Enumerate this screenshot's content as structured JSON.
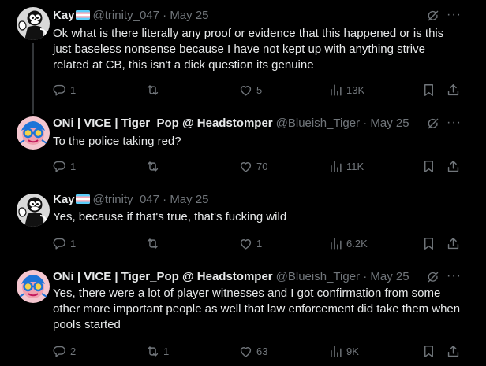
{
  "tweets": [
    {
      "name": "Kay",
      "handle": "@trinity_047",
      "dot": "·",
      "date": "May 25",
      "text": "Ok what is there literally any proof or evidence that this happened or is this just baseless nonsense because I have not kept up with anything strive related at CB, this isn't a dick question its genuine",
      "replies": "1",
      "retweets": "",
      "likes": "5",
      "views": "13K"
    },
    {
      "name": "ONi | VICE | Tiger_Pop @ Headstomper",
      "handle": "@Blueish_Tiger",
      "dot": "·",
      "date": "May 25",
      "text": "To the police taking red?",
      "replies": "1",
      "retweets": "",
      "likes": "70",
      "views": "11K"
    },
    {
      "name": "Kay",
      "handle": "@trinity_047",
      "dot": "·",
      "date": "May 25",
      "text": "Yes, because if that's true, that's fucking wild",
      "replies": "1",
      "retweets": "",
      "likes": "1",
      "views": "6.2K"
    },
    {
      "name": "ONi | VICE | Tiger_Pop @ Headstomper",
      "handle": "@Blueish_Tiger",
      "dot": "·",
      "date": "May 25",
      "text": "Yes, there were a lot of player witnesses and I got confirmation from some other more important people as well that law enforcement did take them when pools started",
      "replies": "2",
      "retweets": "1",
      "likes": "63",
      "views": "9K"
    }
  ],
  "icons": {
    "grok": "grok-icon",
    "more": "more-icon",
    "reply": "reply-icon",
    "retweet": "retweet-icon",
    "like": "heart-icon",
    "views": "views-icon",
    "bookmark": "bookmark-icon",
    "share": "share-icon"
  },
  "more_glyph": "···",
  "colors": {
    "background": "#000000",
    "text": "#e7e9ea",
    "muted": "#71767b",
    "line": "#333639"
  }
}
